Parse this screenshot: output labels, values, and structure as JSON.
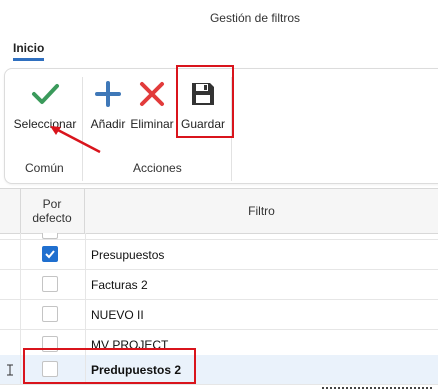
{
  "window": {
    "title": "Gestión de filtros"
  },
  "tabs": [
    {
      "label": "Inicio",
      "active": true
    }
  ],
  "ribbon": {
    "groups": [
      {
        "label": "Común",
        "buttons": [
          {
            "label": "Seleccionar",
            "icon": "checkmark-icon"
          }
        ]
      },
      {
        "label": "Acciones",
        "buttons": [
          {
            "label": "Añadir",
            "icon": "plus-icon"
          },
          {
            "label": "Eliminar",
            "icon": "x-icon"
          },
          {
            "label": "Guardar",
            "icon": "floppy-disk-icon"
          }
        ]
      }
    ]
  },
  "grid": {
    "columns": [
      {
        "label": "Por defecto"
      },
      {
        "label": "Filtro"
      }
    ],
    "rows": [
      {
        "filter": "",
        "default": false
      },
      {
        "filter": "Presupuestos",
        "default": true
      },
      {
        "filter": "Facturas 2",
        "default": false
      },
      {
        "filter": "NUEVO II",
        "default": false
      },
      {
        "filter": "MV PROJECT",
        "default": false
      },
      {
        "filter": "Predupuestos 2",
        "default": false,
        "editing": true
      }
    ]
  },
  "colors": {
    "accent": "#1f6fcf",
    "check_green": "#3a9a5b",
    "delete_red": "#e23b3b",
    "annotation_red": "#d9141c"
  }
}
